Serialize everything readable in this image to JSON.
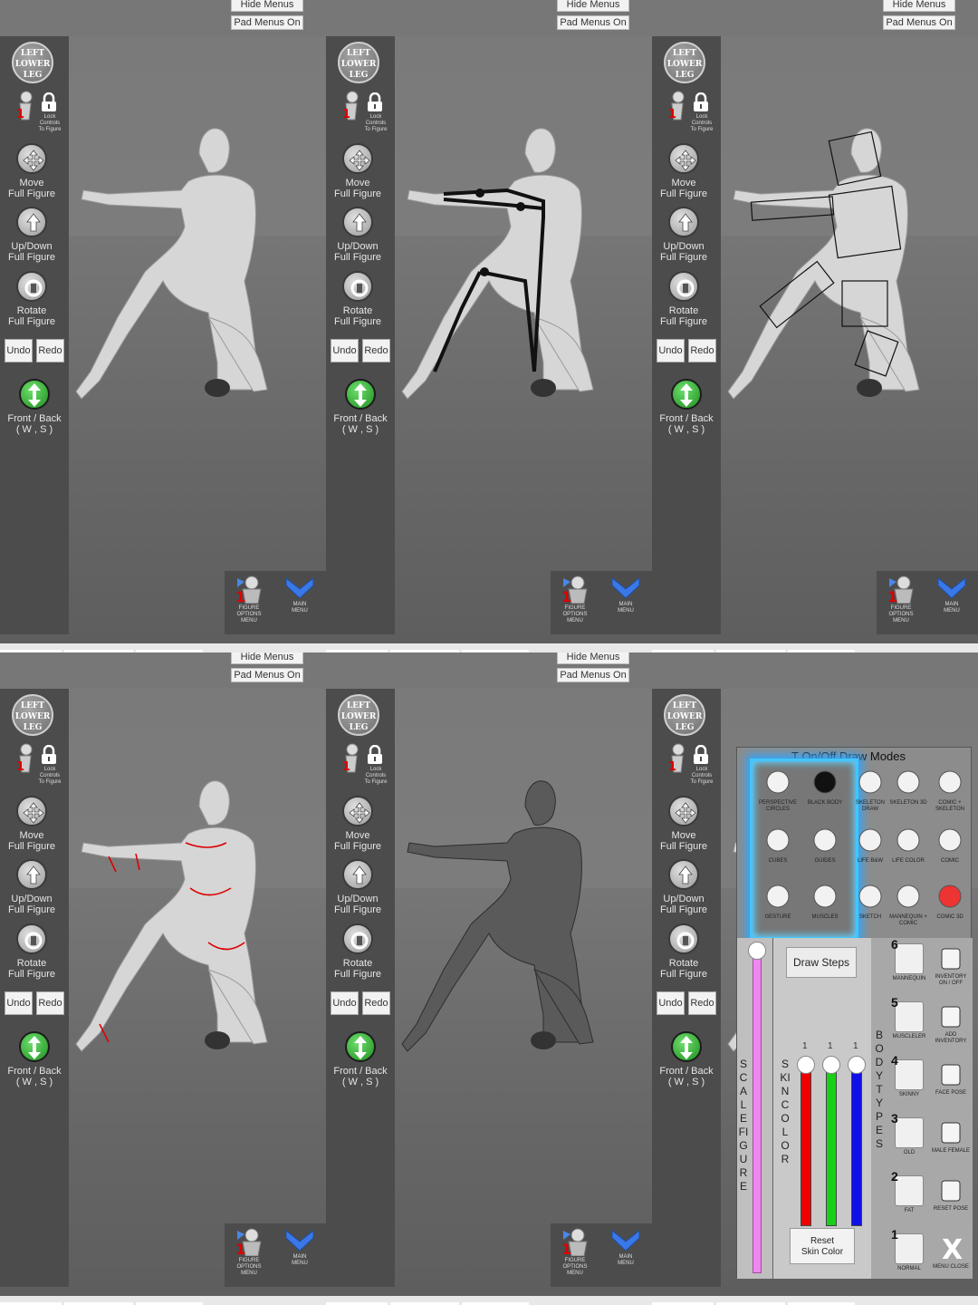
{
  "top_buttons": {
    "hide_menus": "Hide Menus",
    "pad_menus": "Pad Menus On"
  },
  "sidebar": {
    "part_badge": [
      "LEFT",
      "LOWER",
      "LEG"
    ],
    "lock_text": [
      "Lock",
      "Controls",
      "To Figure"
    ],
    "move_label": [
      "Move",
      "Full Figure"
    ],
    "updown_label": [
      "Up/Down",
      "Full Figure"
    ],
    "rotate_label": [
      "Rotate",
      "Full Figure"
    ],
    "undo": "Undo",
    "redo": "Redo",
    "frontback_label": [
      "Front / Back",
      "( W , S )"
    ]
  },
  "bottom_menu": {
    "figure_options": [
      "FIGURE",
      "OPTIONS",
      "MENU"
    ],
    "main_menu": [
      "MAIN",
      "MENU"
    ]
  },
  "draw_modes": {
    "title": "T  On/Off Draw Modes",
    "icons": [
      "PERSPECTIVE CIRCLES",
      "BLACK BODY",
      "SKELETON DRAW",
      "SKELETON 3D",
      "COMIC + SKELETON",
      "CUBES",
      "GUIDES",
      "LIFE B&W",
      "LIFE COLOR",
      "COMIC",
      "GESTURE",
      "MUSCLES",
      "SKETCH",
      "MANNEQUIN + COMIC",
      "COMIC 3D"
    ],
    "draw_steps": "Draw Steps",
    "scale_figure_label": "SCALE FIGURE",
    "skin_color_label": "SKIN COLOR",
    "skin_slider_values": [
      "1",
      "1",
      "1"
    ],
    "reset_skin": [
      "Reset",
      "Skin Color"
    ],
    "body_types_label": "BODY TYPES",
    "body_types": [
      {
        "num": "6",
        "label": "MANNEQUIN"
      },
      {
        "num": "5",
        "label": "MUSCLELER"
      },
      {
        "num": "4",
        "label": "SKINNY"
      },
      {
        "num": "3",
        "label": "OLD"
      },
      {
        "num": "2",
        "label": "FAT"
      },
      {
        "num": "1",
        "label": "NORMAL"
      }
    ],
    "right_column": [
      "INVENTORY ON / OFF",
      "ADD INVENTORY",
      "FACE POSE",
      "MALE FEMALE",
      "RESET POSE",
      "MENU CLOSE"
    ]
  },
  "colors": {
    "sidebar": "#4c4c4c",
    "glow": "#42c6ff",
    "green_button": "#2aa02a",
    "accent_red": "#e00000"
  }
}
